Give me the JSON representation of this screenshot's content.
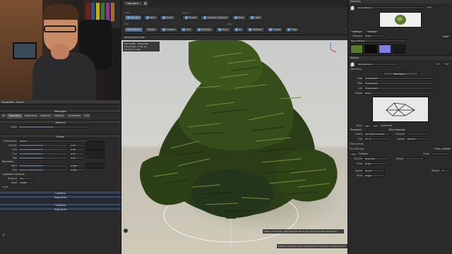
{
  "webcam": {
    "alt": "streamer webcam"
  },
  "toolbar": {
    "doc_tab": "Oke.spm*",
    "view_group": "View",
    "scene_group": "Scene",
    "edit_group": "Edit",
    "pool_group": "Pool",
    "view_buttons": [
      "Render",
      "Wire",
      "Sheet"
    ],
    "scene_buttons": [
      "Terrain",
      "Collision Objects",
      "Wind",
      "Light"
    ],
    "edit_buttons": [
      "Generators",
      "Nodes",
      "Creases",
      "Add",
      "Visibility",
      "Store",
      "All",
      "Collision",
      "Export",
      "Help"
    ]
  },
  "viewport": {
    "header": "perspective view",
    "info_lines": [
      "POLYGONS : SELECTED",
      "Polys/Edge: 3,281 Ks",
      "Vertices: 15.9K"
    ],
    "status": "LOD (Lvl Thread): Last Compute 81.37 ms (draw to draw 179.13 ms)",
    "status2": "LOD (Lvl Thread) Last Compute 81.37 ms (draw to draw 179.13 ms)"
  },
  "props": {
    "title": "Properties - Frond",
    "tabs_label": "Messages",
    "tabs": [
      "All",
      "Geometry",
      "Segments",
      "Material",
      "Collision",
      "Animation",
      "LOD"
    ],
    "material_section": "Material",
    "index_label": "Index",
    "shape_section": "Shape",
    "rows": [
      {
        "label": "Subdivision",
        "value": "Global"
      },
      {
        "label": "Gravity",
        "value": "0.16"
      },
      {
        "label": "Fold",
        "value": "0.30"
      },
      {
        "label": "Curl",
        "value": "0.75"
      },
      {
        "label": "Roll",
        "value": "0.14"
      }
    ],
    "boundary_section": "Boundary",
    "boundary_rows": [
      {
        "label": "Start",
        "value": "0.000"
      },
      {
        "label": "End",
        "value": "0.000"
      }
    ],
    "lightvar_section": "Lightlight variance",
    "lightvar_rows": [
      {
        "label": "Amount",
        "value": "0.0"
      },
      {
        "label": "Seed",
        "value": "15485"
      }
    ],
    "scale_label": "Scale",
    "bottom_sections": [
      "Lighting",
      "Segments",
      "Lighting",
      "Segments"
    ]
  },
  "right": {
    "materials_title": "Materials",
    "material_name": "SpruceFrond",
    "add_label": "Add",
    "settings_tabs": [
      "Settings",
      "Meshes"
    ],
    "category_label": "Category",
    "category_value": "Frond",
    "name_value": "SpruceFrond",
    "meshes_title": "Meshes",
    "mesh_name": "SpruceFrond",
    "geometry_label": "Geometry",
    "edit_mesh_btn": "Edit Mesh...",
    "lod_rows": [
      {
        "label": "High",
        "value": "Unassigned"
      },
      {
        "label": "Med",
        "value": "Unassigned"
      },
      {
        "label": "Low",
        "value": "Unassigned"
      },
      {
        "label": "Shape",
        "value": "None"
      }
    ],
    "show_label": "Show",
    "alignment_label": "Alignment",
    "transform_title": "Transform",
    "wind_title": "Wind direction",
    "orient_label": "Orient",
    "orient_value": "Up (right-handed)",
    "flip_label": "Flip",
    "flip_value": "X Y Z",
    "forward_label": "Forward",
    "upaxis_label": "Upaxis",
    "upaxis_value": "Normal",
    "flip_normals_label": "Flip normals",
    "pin_label": "Pin vertically",
    "proxy_title": "Proxy collision",
    "collision_label": "Collision",
    "scale_label": "Scale",
    "height_label": "Height",
    "convex_label": "Convex",
    "convex_value": "Branches",
    "pivot_label": "Pivot",
    "pivot_value": "Origin",
    "ignore_label": "Ignore",
    "ignore_value": "Ignore",
    "pivot2_label": "Pivot",
    "pivot2_value": "Origin",
    "weight_label": "Weight",
    "weight_value": "1"
  },
  "colors": {
    "foliage_dark": "#1f2e12",
    "foliage_mid": "#3f5a1e",
    "foliage_light": "#7a8f3c",
    "accent": "#4f6c8e"
  }
}
